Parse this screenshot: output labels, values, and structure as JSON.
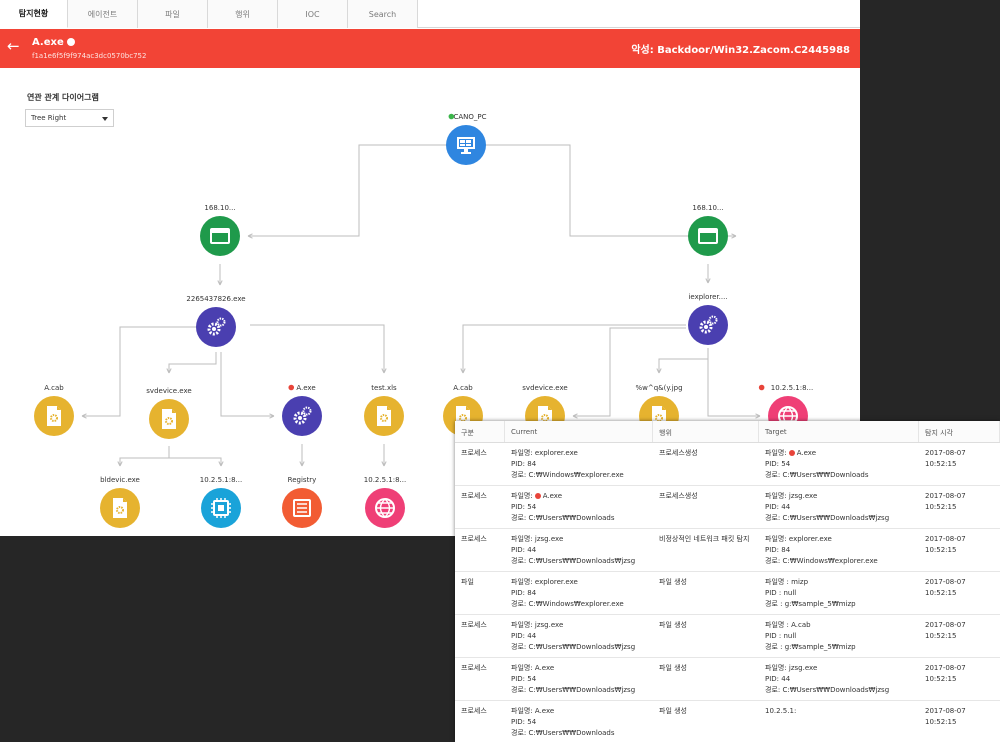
{
  "tabs": [
    "탐지현황",
    "에이전트",
    "파일",
    "행위",
    "IOC",
    "Search"
  ],
  "header": {
    "file_name": "A.exe",
    "hash": "f1a1e6f5f9f974ac3dc0570bc752",
    "malware": "악성: Backdoor/Win32.Zacom.C2445988"
  },
  "diagram": {
    "label": "연관 관계 다이어그램",
    "layout_option": "Tree Right",
    "nodes": [
      {
        "id": "pc",
        "label": "CANO_PC",
        "icon": "windows-pc-icon",
        "color": "#2f86e0",
        "status": "#3bb54a"
      },
      {
        "id": "w1",
        "label": "168.10...",
        "icon": "browser-window-icon",
        "color": "#1f9a4b"
      },
      {
        "id": "w2",
        "label": "168.10...",
        "icon": "browser-window-icon",
        "color": "#1f9a4b"
      },
      {
        "id": "p1",
        "label": "2265437826.exe",
        "icon": "gears-icon",
        "color": "#4a3fb0"
      },
      {
        "id": "p2",
        "label": "iexplorer....",
        "icon": "gears-icon",
        "color": "#4a3fb0"
      },
      {
        "id": "f1",
        "label": "A.cab",
        "icon": "file-gear-icon",
        "color": "#e6b32f"
      },
      {
        "id": "f2",
        "label": "svdevice.exe",
        "icon": "file-gear-icon",
        "color": "#e6b32f"
      },
      {
        "id": "p3",
        "label": "A.exe",
        "icon": "gears-icon",
        "color": "#4a3fb0",
        "status": "#e8443a",
        "highlight": true
      },
      {
        "id": "f3",
        "label": "test.xls",
        "icon": "file-gear-icon",
        "color": "#e6b32f"
      },
      {
        "id": "f4",
        "label": "A.cab",
        "icon": "file-gear-icon",
        "color": "#e6b32f"
      },
      {
        "id": "f5",
        "label": "svdevice.exe",
        "icon": "file-gear-icon",
        "color": "#e6b32f"
      },
      {
        "id": "f6",
        "label": "%w^q&(y.jpg",
        "icon": "file-gear-icon",
        "color": "#e6b32f"
      },
      {
        "id": "n1",
        "label": "10.2.5.1:8...",
        "icon": "globe-icon",
        "color": "#ef3f76",
        "status": "#e8443a"
      },
      {
        "id": "f7",
        "label": "bldevic.exe",
        "icon": "file-gear-icon",
        "color": "#e6b32f"
      },
      {
        "id": "c1",
        "label": "10.2.5.1:8...",
        "icon": "chip-icon",
        "color": "#1aa3d9"
      },
      {
        "id": "r1",
        "label": "Registry",
        "icon": "registry-list-icon",
        "color": "#f25c33"
      },
      {
        "id": "n2",
        "label": "10.2.5.1:8...",
        "icon": "globe-icon",
        "color": "#ef3f76"
      }
    ]
  },
  "table": {
    "headers": [
      "구분",
      "Current",
      "행위",
      "Target",
      "탐지 시각"
    ],
    "rows": [
      {
        "type": "프로세스",
        "current": [
          "파일명: explorer.exe",
          "PID: 84",
          "경로: C:₩Windows₩explorer.exe"
        ],
        "action": "프로세스생성",
        "target": [
          "파일명: A.exe",
          "PID: 54",
          "경로: C:₩Users₩₩Downloads"
        ],
        "target_dot": true,
        "time": "2017-08-07 10:52:15"
      },
      {
        "type": "프로세스",
        "current": [
          "파일명: A.exe",
          "PID: 54",
          "경로: C:₩Users₩₩Downloads"
        ],
        "current_dot": true,
        "action": "프로세스생성",
        "target": [
          "파일명: jzsg.exe",
          "PID: 44",
          "경로: C:₩Users₩₩Downloads₩jzsg"
        ],
        "time": "2017-08-07 10:52:15"
      },
      {
        "type": "프로세스",
        "current": [
          "파일명: jzsg.exe",
          "PID: 44",
          "경로: C:₩Users₩₩Downloads₩jzsg"
        ],
        "action": "비정상적인 네트워크 패킷 탐지",
        "target": [
          "파일명: explorer.exe",
          "PID: 84",
          "경로: C:₩Windows₩explorer.exe"
        ],
        "time": "2017-08-07 10:52:15"
      },
      {
        "type": "파일",
        "current": [
          "파일명: explorer.exe",
          "PID: 84",
          "경로: C:₩Windows₩explorer.exe"
        ],
        "action": "파일 생성",
        "target": [
          "파일명 : mizp",
          "PID : null",
          "경로 : g:₩sample_5₩mizp"
        ],
        "time": "2017-08-07 10:52:15"
      },
      {
        "type": "프로세스",
        "current": [
          "파일명: jzsg.exe",
          "PID: 44",
          "경로: C:₩Users₩₩Downloads₩jzsg"
        ],
        "action": "파일 생성",
        "target": [
          "파일명 : A.cab",
          "PID : null",
          "경로 : g:₩sample_5₩mizp"
        ],
        "time": "2017-08-07 10:52:15"
      },
      {
        "type": "프로세스",
        "current": [
          "파일명: A.exe",
          "PID: 54",
          "경로: C:₩Users₩₩Downloads₩jzsg"
        ],
        "action": "파일 생성",
        "target": [
          "파일명: jzsg.exe",
          "PID: 44",
          "경로: C:₩Users₩₩Downloads₩jzsg"
        ],
        "time": "2017-08-07 10:52:15"
      },
      {
        "type": "프로세스",
        "current": [
          "파일명: A.exe",
          "PID: 54",
          "경로: C:₩Users₩₩Downloads"
        ],
        "action": "파일 생성",
        "target": [
          "10.2.5.1:"
        ],
        "time": "2017-08-07 10:52:15"
      }
    ]
  }
}
